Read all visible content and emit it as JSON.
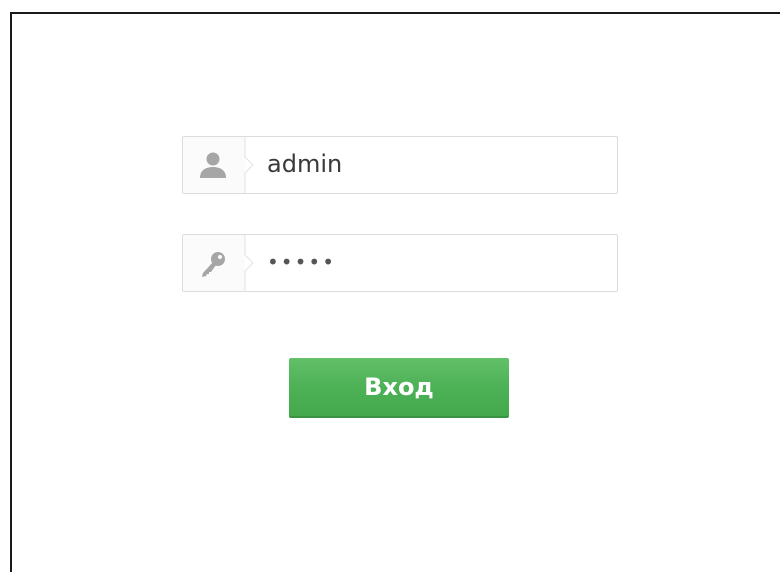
{
  "login": {
    "username_value": "admin",
    "password_value": "•••••",
    "submit_label": "Вход"
  },
  "icons": {
    "username": "user-icon",
    "password": "key-icon"
  },
  "colors": {
    "button": "#4db156",
    "border": "#dcdcdc",
    "icon": "#a6a6a6"
  }
}
